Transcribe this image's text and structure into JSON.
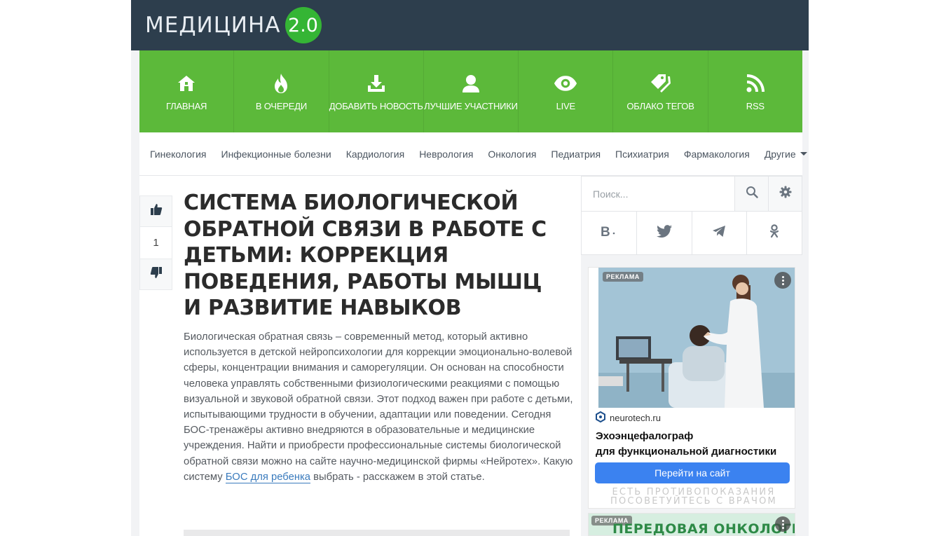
{
  "logo": {
    "text": "МЕДИЦИНА",
    "badge": "2.0"
  },
  "main_nav": [
    {
      "label": "ГЛАВНАЯ",
      "icon": "home-icon"
    },
    {
      "label": "В ОЧЕРЕДИ",
      "icon": "fire-icon"
    },
    {
      "label": "ДОБАВИТЬ НОВОСТЬ",
      "icon": "download-icon"
    },
    {
      "label": "ЛУЧШИЕ УЧАСТНИКИ",
      "icon": "user-icon"
    },
    {
      "label": "LIVE",
      "icon": "eye-icon"
    },
    {
      "label": "ОБЛАКО ТЕГОВ",
      "icon": "tags-icon"
    },
    {
      "label": "RSS",
      "icon": "rss-icon"
    }
  ],
  "categories": [
    "Гинекология",
    "Инфекционные болезни",
    "Кардиология",
    "Неврология",
    "Онкология",
    "Педиатрия",
    "Психиатрия",
    "Фармакология"
  ],
  "categories_more": "Другие",
  "vote": {
    "count": "1"
  },
  "article": {
    "title": "СИСТЕМА БИОЛОГИЧЕСКОЙ ОБРАТНОЙ СВЯЗИ В РАБОТЕ С ДЕТЬМИ: КОРРЕКЦИЯ ПОВЕДЕНИЯ, РАБОТЫ МЫШЦ И РАЗВИТИЕ НАВЫКОВ",
    "lead_before_link": "Биологическая обратная связь – современный метод, который активно используется в детской нейропсихологии для коррекции эмоционально-волевой сферы, концентрации внимания и саморегуляции. Он основан на способности человека управлять собственными физиологическими реакциями с помощью визуальной и звуковой обратной связи. Этот подход важен при работе с детьми, испытывающими трудности в обучении, адаптации или поведении. Сегодня БОС-тренажёры активно внедряются в образовательные и медицинские учреждения. Найти и приобрести профессиональные системы биологической обратной связи можно на сайте научно-медицинской фирмы «Нейротех». Какую систему ",
    "lead_link": "БОС для ребенка",
    "lead_after_link": " выбрать - расскажем в этой статье."
  },
  "search": {
    "placeholder": "Поиск..."
  },
  "social": [
    "vk-icon",
    "twitter-icon",
    "telegram-icon",
    "odnoklassniki-icon"
  ],
  "ad": {
    "badge": "РЕКЛАМА",
    "domain": "neurotech.ru",
    "title_line1": "Эхоэнцефалограф",
    "title_line2": "для функциональной диагностики",
    "cta": "Перейти на сайт",
    "warning_line1": "ЕСТЬ ПРОТИВОПОКАЗАНИЯ",
    "warning_line2": "ПОСОВЕТУЙТЕСЬ С ВРАЧОМ"
  },
  "ad2": {
    "badge": "РЕКЛАМА",
    "title": "ПЕРЕДОВАЯ ОНКОЛОГИЯ"
  },
  "colors": {
    "topbar": "#2d3e4d",
    "nav_green": "#5cb93a",
    "logo_badge": "#35b535",
    "link": "#3a7bbd",
    "cta": "#3b82f0"
  }
}
